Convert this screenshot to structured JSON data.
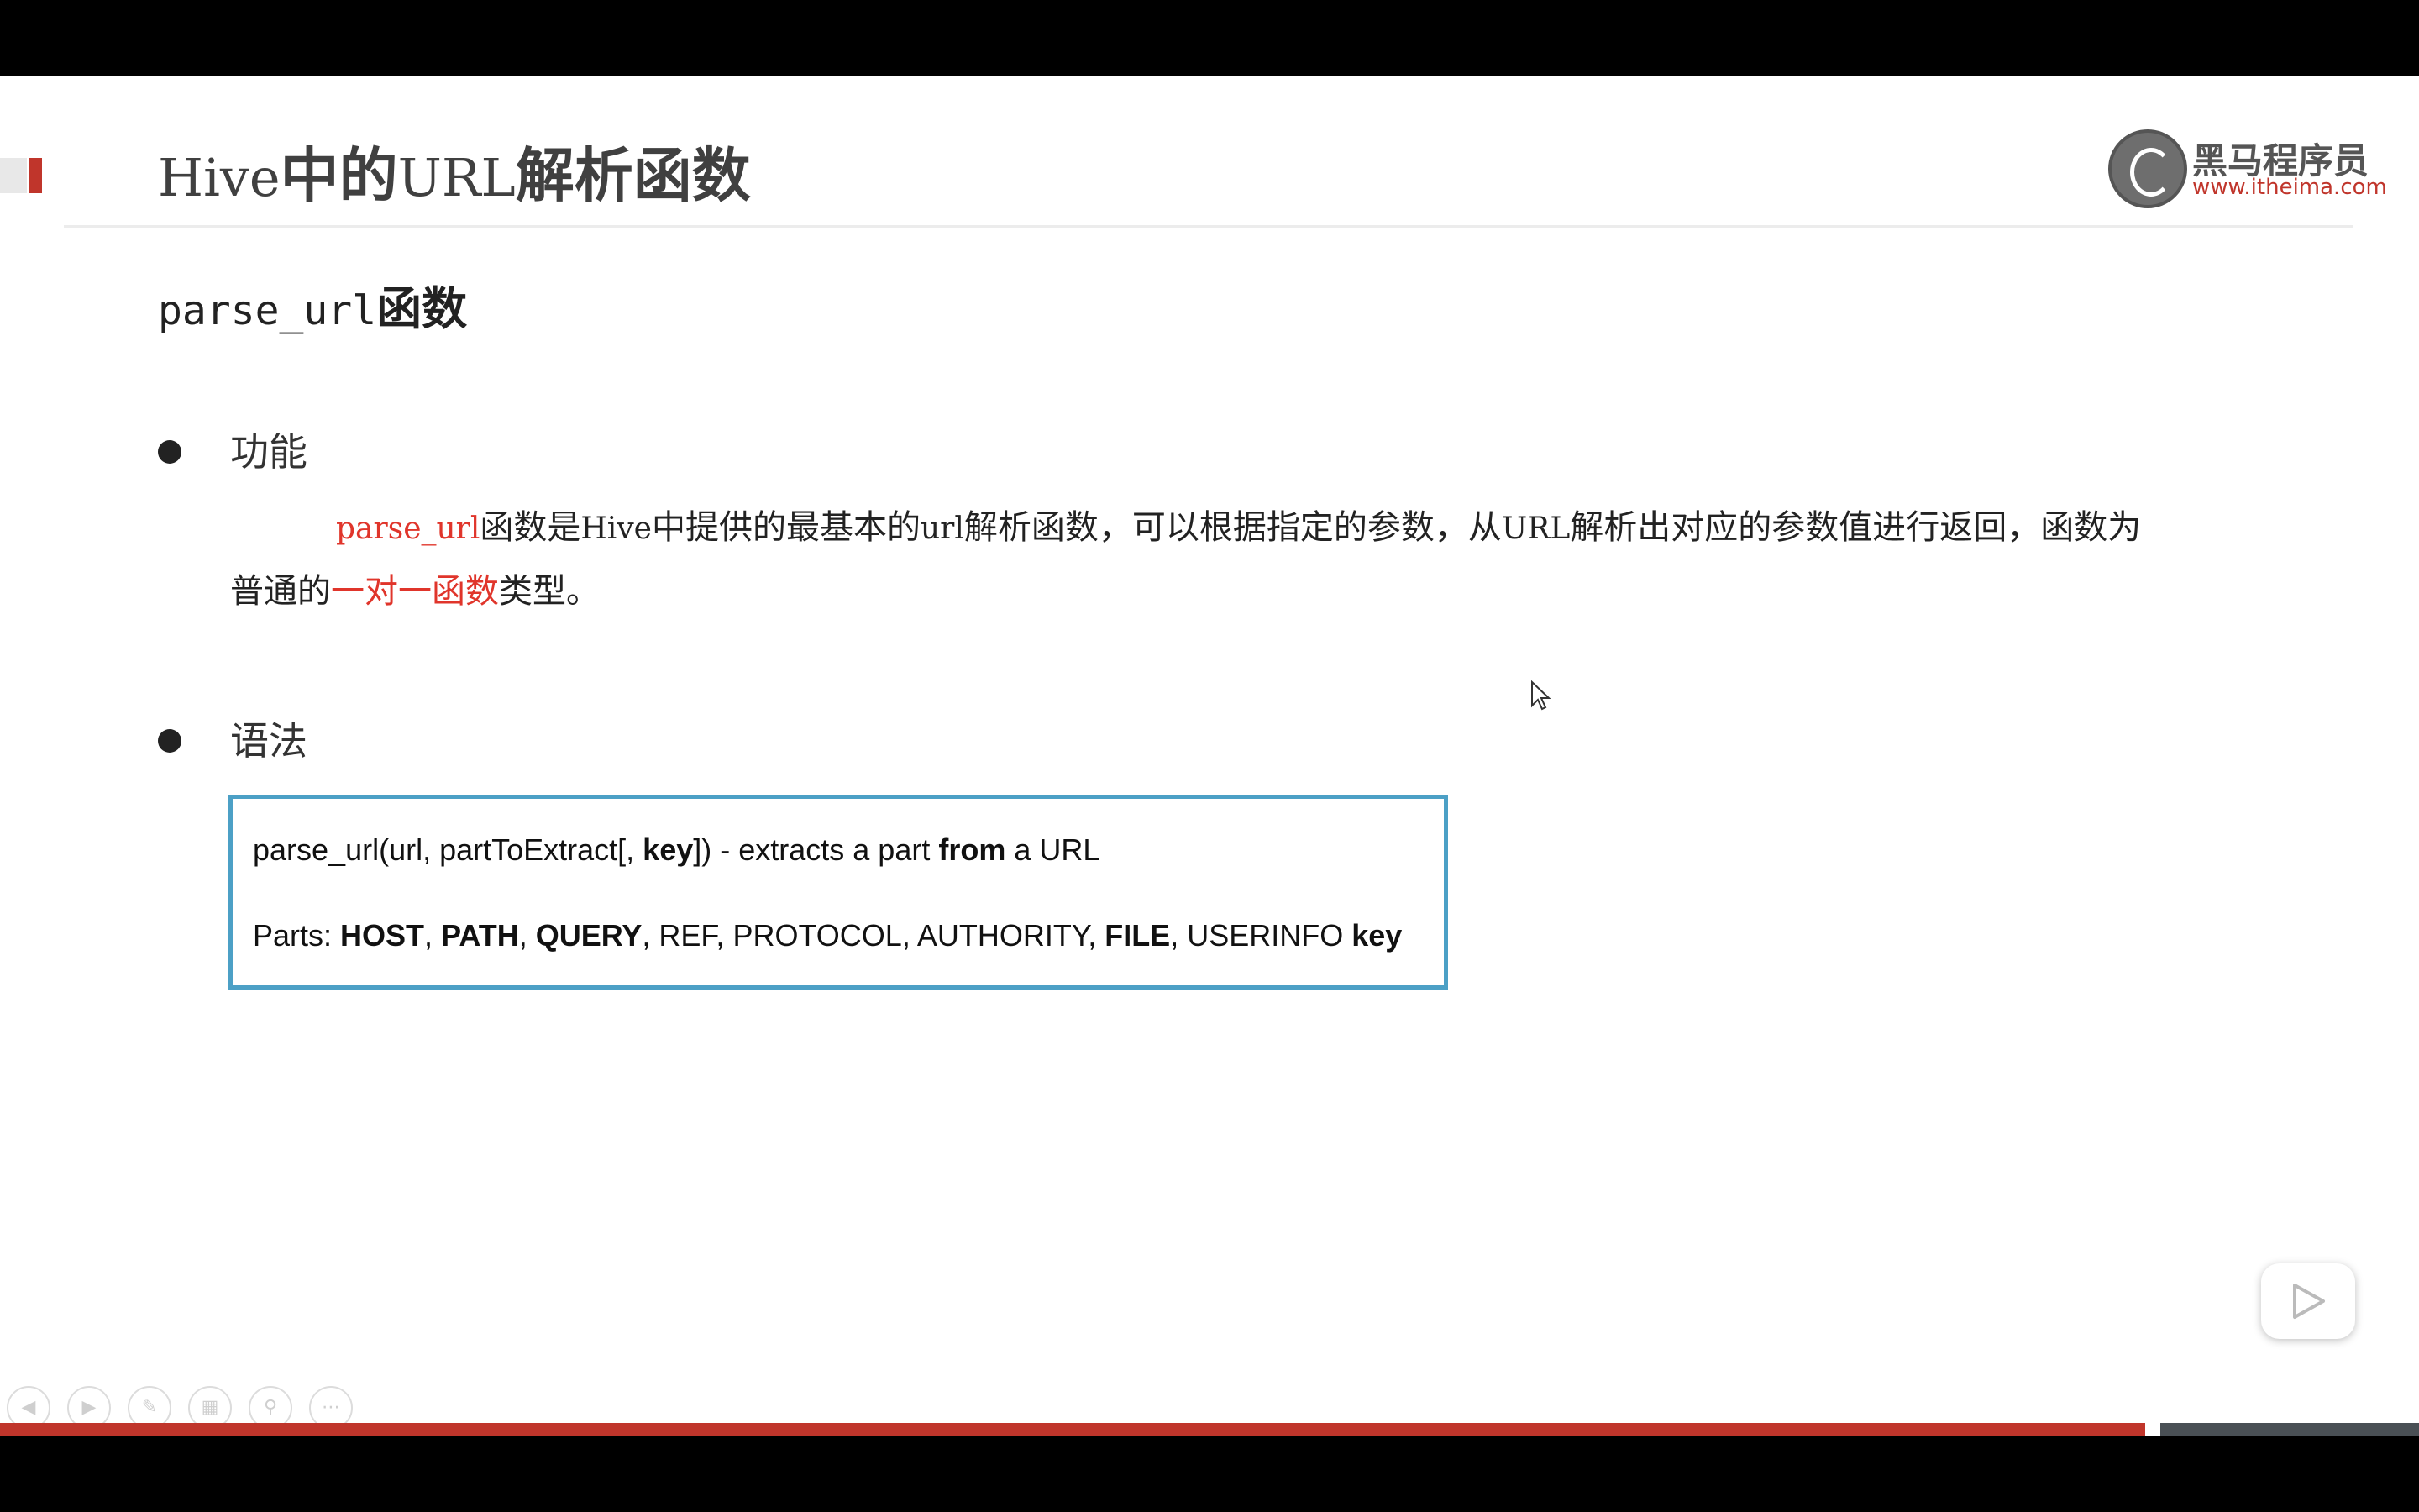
{
  "slide": {
    "title_prefix": "Hive",
    "title_mid": "中的",
    "title_url": "URL",
    "title_suffix": "解析函数",
    "logo_name": "黑马程序员",
    "logo_url": "www.itheima.com",
    "subtitle_code": "parse_url",
    "subtitle_text": "函数",
    "section1_heading": "功能",
    "para_line1": {
      "code": "parse_url",
      "t1": "函数是",
      "hive": "Hive",
      "t2": "中提供的最基本的",
      "url_lower": "url",
      "t3": "解析函数，可以根据指定的参数，从",
      "url_upper": "URL",
      "t4": "解析出对应的参数值进行返回，函数为"
    },
    "para_line2": {
      "t1": "普通的",
      "red": "一对一函数",
      "t2": "类型。"
    },
    "section2_heading": "语法",
    "syntax": {
      "line1_a": "parse_url(url, partToExtract[, ",
      "line1_key": "key",
      "line1_b": "]) - extracts a part ",
      "line1_from": "from",
      "line1_c": " a URL",
      "line2_parts": "Parts: ",
      "host": "HOST",
      "comma1": ", ",
      "path": "PATH",
      "comma2": ", ",
      "query": "QUERY",
      "mid": ", REF, PROTOCOL, AUTHORITY, ",
      "file": "FILE",
      "userinfo": ", USERINFO ",
      "key": "key"
    }
  },
  "player": {
    "play_icon": "play-icon",
    "toolbar_icons": [
      "prev-icon",
      "next-icon",
      "pen-icon",
      "slides-icon",
      "zoom-icon",
      "more-icon"
    ],
    "progress_fraction": 0.887
  },
  "colors": {
    "accent_red": "#c0352b",
    "highlight_red": "#e0352b",
    "box_border": "#4ca0c6"
  }
}
